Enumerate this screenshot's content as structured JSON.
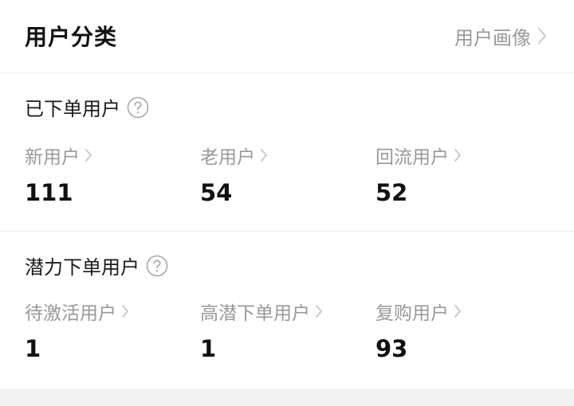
{
  "header": {
    "title": "用户分类",
    "link_label": "用户画像"
  },
  "ordered_users": {
    "title": "已下单用户",
    "stats": [
      {
        "label": "新用户",
        "value": "111"
      },
      {
        "label": "老用户",
        "value": "54"
      },
      {
        "label": "回流用户",
        "value": "52"
      }
    ]
  },
  "potential_users": {
    "title": "潜力下单用户",
    "stats": [
      {
        "label": "待激活用户",
        "value": "1"
      },
      {
        "label": "高潜下单用户",
        "value": "1"
      },
      {
        "label": "复购用户",
        "value": "93"
      }
    ]
  },
  "icons": {
    "help": "question-circle-icon",
    "chevron": "chevron-right-icon"
  },
  "colors": {
    "text_primary": "#111111",
    "text_secondary": "#999999",
    "divider": "#eeeeee",
    "footer_bg": "#f2f2f2"
  }
}
